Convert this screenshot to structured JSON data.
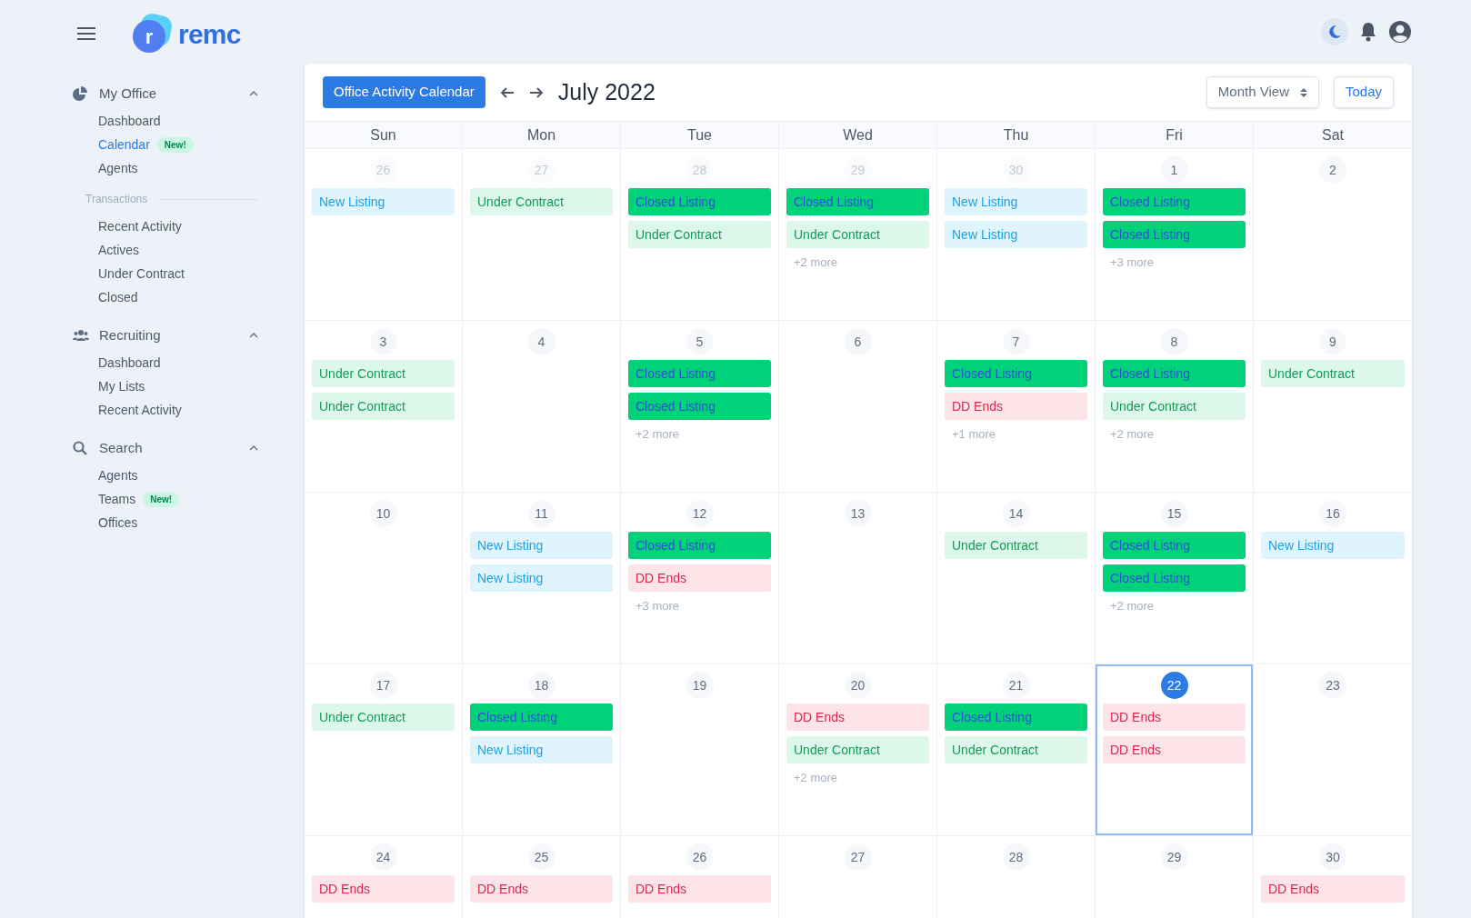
{
  "brand": {
    "name": "remc",
    "mark": "r"
  },
  "sidebar": {
    "sections": [
      {
        "title": "My Office",
        "expanded": true,
        "items": [
          {
            "kind": "link",
            "label": "Dashboard",
            "selected": false
          },
          {
            "kind": "link",
            "label": "Calendar",
            "selected": true,
            "badge": "New!"
          },
          {
            "kind": "link",
            "label": "Agents",
            "selected": false
          },
          {
            "kind": "heading",
            "label": "Transactions"
          },
          {
            "kind": "link",
            "label": "Recent Activity",
            "selected": false
          },
          {
            "kind": "link",
            "label": "Actives",
            "selected": false
          },
          {
            "kind": "link",
            "label": "Under Contract",
            "selected": false
          },
          {
            "kind": "link",
            "label": "Closed",
            "selected": false
          }
        ]
      },
      {
        "title": "Recruiting",
        "expanded": true,
        "items": [
          {
            "kind": "link",
            "label": "Dashboard",
            "selected": false
          },
          {
            "kind": "link",
            "label": "My Lists",
            "selected": false
          },
          {
            "kind": "link",
            "label": "Recent Activity",
            "selected": false
          }
        ]
      },
      {
        "title": "Search",
        "expanded": true,
        "items": [
          {
            "kind": "link",
            "label": "Agents",
            "selected": false
          },
          {
            "kind": "link",
            "label": "Teams",
            "selected": false,
            "badge": "New!"
          },
          {
            "kind": "link",
            "label": "Offices",
            "selected": false
          }
        ]
      }
    ]
  },
  "calendar": {
    "title": "Office Activity Calendar",
    "month": "July 2022",
    "view": "Month View",
    "today_button": "Today",
    "weekdays": [
      "Sun",
      "Mon",
      "Tue",
      "Wed",
      "Thu",
      "Fri",
      "Sat"
    ],
    "weeks": [
      [
        {
          "day": "26",
          "outside": true,
          "today": false,
          "events": [
            {
              "kind": "new",
              "label": "New Listing"
            }
          ]
        },
        {
          "day": "27",
          "outside": true,
          "today": false,
          "events": [
            {
              "kind": "under",
              "label": "Under Contract"
            }
          ]
        },
        {
          "day": "28",
          "outside": true,
          "today": false,
          "events": [
            {
              "kind": "closed",
              "label": "Closed Listing"
            },
            {
              "kind": "under",
              "label": "Under Contract"
            }
          ]
        },
        {
          "day": "29",
          "outside": true,
          "today": false,
          "events": [
            {
              "kind": "closed",
              "label": "Closed Listing"
            },
            {
              "kind": "under",
              "label": "Under Contract"
            }
          ],
          "more": "+2 more"
        },
        {
          "day": "30",
          "outside": true,
          "today": false,
          "events": [
            {
              "kind": "new",
              "label": "New Listing"
            },
            {
              "kind": "new",
              "label": "New Listing"
            }
          ]
        },
        {
          "day": "1",
          "outside": false,
          "today": false,
          "events": [
            {
              "kind": "closed",
              "label": "Closed Listing"
            },
            {
              "kind": "closed",
              "label": "Closed Listing"
            }
          ],
          "more": "+3 more"
        },
        {
          "day": "2",
          "outside": false,
          "today": false
        }
      ],
      [
        {
          "day": "3",
          "outside": false,
          "today": false,
          "events": [
            {
              "kind": "under",
              "label": "Under Contract"
            },
            {
              "kind": "under",
              "label": "Under Contract"
            }
          ]
        },
        {
          "day": "4",
          "outside": false,
          "today": false
        },
        {
          "day": "5",
          "outside": false,
          "today": false,
          "events": [
            {
              "kind": "closed",
              "label": "Closed Listing"
            },
            {
              "kind": "closed",
              "label": "Closed Listing"
            }
          ],
          "more": "+2 more"
        },
        {
          "day": "6",
          "outside": false,
          "today": false
        },
        {
          "day": "7",
          "outside": false,
          "today": false,
          "events": [
            {
              "kind": "closed",
              "label": "Closed Listing"
            },
            {
              "kind": "dd",
              "label": "DD Ends"
            }
          ],
          "more": "+1 more"
        },
        {
          "day": "8",
          "outside": false,
          "today": false,
          "events": [
            {
              "kind": "closed",
              "label": "Closed Listing"
            },
            {
              "kind": "under",
              "label": "Under Contract"
            }
          ],
          "more": "+2 more"
        },
        {
          "day": "9",
          "outside": false,
          "today": false,
          "events": [
            {
              "kind": "under",
              "label": "Under Contract"
            }
          ]
        }
      ],
      [
        {
          "day": "10",
          "outside": false,
          "today": false
        },
        {
          "day": "11",
          "outside": false,
          "today": false,
          "events": [
            {
              "kind": "new",
              "label": "New Listing"
            },
            {
              "kind": "new",
              "label": "New Listing"
            }
          ]
        },
        {
          "day": "12",
          "outside": false,
          "today": false,
          "events": [
            {
              "kind": "closed",
              "label": "Closed Listing"
            },
            {
              "kind": "dd",
              "label": "DD Ends"
            }
          ],
          "more": "+3 more"
        },
        {
          "day": "13",
          "outside": false,
          "today": false
        },
        {
          "day": "14",
          "outside": false,
          "today": false,
          "events": [
            {
              "kind": "under",
              "label": "Under Contract"
            }
          ]
        },
        {
          "day": "15",
          "outside": false,
          "today": false,
          "events": [
            {
              "kind": "closed",
              "label": "Closed Listing"
            },
            {
              "kind": "closed",
              "label": "Closed Listing"
            }
          ],
          "more": "+2 more"
        },
        {
          "day": "16",
          "outside": false,
          "today": false,
          "events": [
            {
              "kind": "new",
              "label": "New Listing"
            }
          ]
        }
      ],
      [
        {
          "day": "17",
          "outside": false,
          "today": false,
          "events": [
            {
              "kind": "under",
              "label": "Under Contract"
            }
          ]
        },
        {
          "day": "18",
          "outside": false,
          "today": false,
          "events": [
            {
              "kind": "closed",
              "label": "Closed Listing"
            },
            {
              "kind": "new",
              "label": "New Listing"
            }
          ]
        },
        {
          "day": "19",
          "outside": false,
          "today": false
        },
        {
          "day": "20",
          "outside": false,
          "today": false,
          "events": [
            {
              "kind": "dd",
              "label": "DD Ends"
            },
            {
              "kind": "under",
              "label": "Under Contract"
            }
          ],
          "more": "+2 more"
        },
        {
          "day": "21",
          "outside": false,
          "today": false,
          "events": [
            {
              "kind": "closed",
              "label": "Closed Listing"
            },
            {
              "kind": "under",
              "label": "Under Contract"
            }
          ]
        },
        {
          "day": "22",
          "outside": false,
          "today": true,
          "events": [
            {
              "kind": "dd",
              "label": "DD Ends"
            },
            {
              "kind": "dd",
              "label": "DD Ends"
            }
          ]
        },
        {
          "day": "23",
          "outside": false,
          "today": false
        }
      ],
      [
        {
          "day": "24",
          "outside": false,
          "today": false,
          "events": [
            {
              "kind": "dd",
              "label": "DD Ends"
            }
          ]
        },
        {
          "day": "25",
          "outside": false,
          "today": false,
          "events": [
            {
              "kind": "dd",
              "label": "DD Ends"
            }
          ]
        },
        {
          "day": "26",
          "outside": false,
          "today": false,
          "events": [
            {
              "kind": "dd",
              "label": "DD Ends"
            }
          ]
        },
        {
          "day": "27",
          "outside": false,
          "today": false
        },
        {
          "day": "28",
          "outside": false,
          "today": false
        },
        {
          "day": "29",
          "outside": false,
          "today": false
        },
        {
          "day": "30",
          "outside": false,
          "today": false,
          "events": [
            {
              "kind": "dd",
              "label": "DD Ends"
            }
          ]
        }
      ]
    ]
  }
}
